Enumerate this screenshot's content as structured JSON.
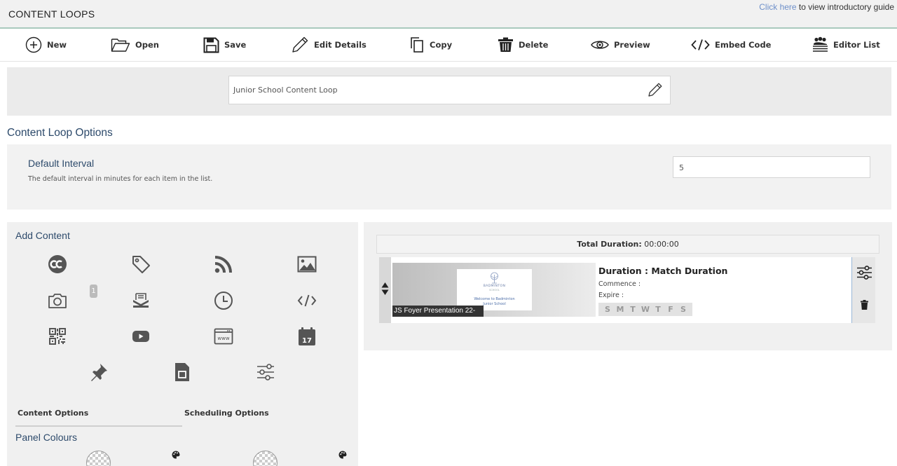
{
  "app": {
    "title": "CONTENT LOOPS",
    "guide_link": "Click here",
    "guide_text": " to view introductory guide"
  },
  "toolbar": {
    "new": "New",
    "open": "Open",
    "save": "Save",
    "edit_details": "Edit Details",
    "copy": "Copy",
    "delete": "Delete",
    "preview": "Preview",
    "embed_code": "Embed Code",
    "editor_list": "Editor List"
  },
  "loop": {
    "name": "Junior School Content Loop"
  },
  "options": {
    "section_title": "Content Loop Options",
    "default_interval_label": "Default Interval",
    "default_interval_desc": "The default interval in minutes for each item in the list.",
    "default_interval_value": "5"
  },
  "add_content": {
    "title": "Add Content",
    "badge_count": "1",
    "icons": [
      "creative-commons-icon",
      "tag-icon",
      "rss-icon",
      "image-icon",
      "camera-icon",
      "mail-icon",
      "clock-icon",
      "code-icon",
      "qr-code-icon",
      "youtube-icon",
      "web-page-icon",
      "calendar-icon",
      "pin-icon",
      "document-icon",
      "sliders-icon"
    ],
    "calendar_day": "17",
    "web_label": "www",
    "tabs": {
      "content": "Content Options",
      "scheduling": "Scheduling Options"
    },
    "panel_colours": "Panel Colours"
  },
  "playlist": {
    "total_label": "Total Duration:",
    "total_value": " 00:00:00",
    "items": [
      {
        "caption": "JS Foyer Presentation 22-",
        "thumb_school": "BADMINTON",
        "thumb_sub": "SCHOOL",
        "thumb_welcome_1": "Welcome to Badminton",
        "thumb_welcome_2": "Junior School",
        "duration": "Duration : Match Duration",
        "commence": "Commence :",
        "expire": "Expire :",
        "days": [
          "S",
          "M",
          "T",
          "W",
          "T",
          "F",
          "S"
        ]
      }
    ]
  }
}
